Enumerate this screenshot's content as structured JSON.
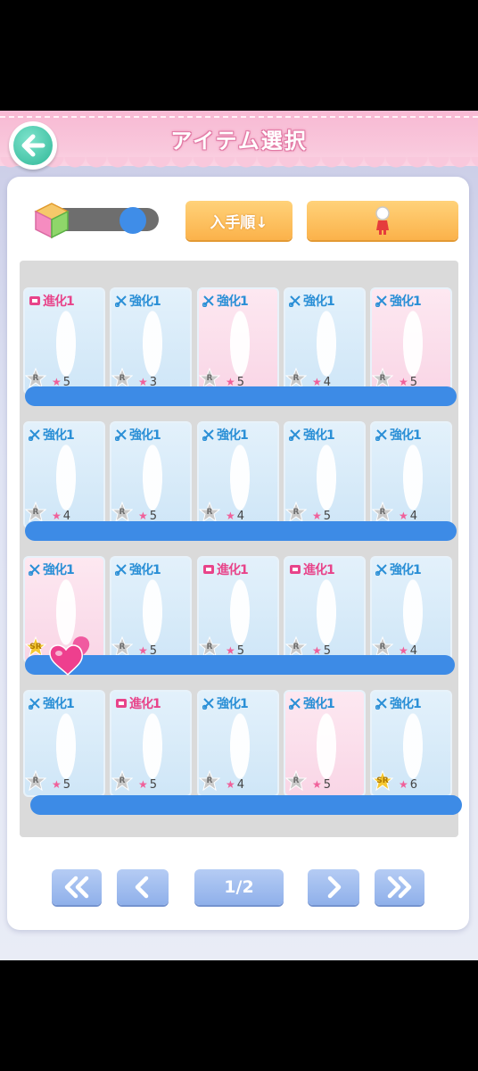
{
  "header": {
    "title": "アイテム選択"
  },
  "toolbar": {
    "sort_label": "入手順↓"
  },
  "pager": {
    "page": "1/2"
  },
  "items": [
    {
      "tag": "進化1",
      "type": "evo",
      "rank": "R",
      "stars": "5",
      "bg": "blue"
    },
    {
      "tag": "強化1",
      "type": "enh",
      "rank": "R",
      "stars": "3",
      "bg": "blue"
    },
    {
      "tag": "強化1",
      "type": "enh",
      "rank": "R",
      "stars": "5",
      "bg": "pink"
    },
    {
      "tag": "強化1",
      "type": "enh",
      "rank": "R",
      "stars": "4",
      "bg": "blue"
    },
    {
      "tag": "強化1",
      "type": "enh",
      "rank": "R",
      "stars": "5",
      "bg": "pink"
    },
    {
      "tag": "強化1",
      "type": "enh",
      "rank": "R",
      "stars": "4",
      "bg": "blue"
    },
    {
      "tag": "強化1",
      "type": "enh",
      "rank": "R",
      "stars": "5",
      "bg": "blue"
    },
    {
      "tag": "強化1",
      "type": "enh",
      "rank": "R",
      "stars": "4",
      "bg": "blue"
    },
    {
      "tag": "強化1",
      "type": "enh",
      "rank": "R",
      "stars": "5",
      "bg": "blue"
    },
    {
      "tag": "強化1",
      "type": "enh",
      "rank": "R",
      "stars": "4",
      "bg": "blue"
    },
    {
      "tag": "強化1",
      "type": "enh",
      "rank": "SR",
      "stars": "",
      "bg": "pink"
    },
    {
      "tag": "強化1",
      "type": "enh",
      "rank": "R",
      "stars": "5",
      "bg": "blue"
    },
    {
      "tag": "進化1",
      "type": "evo",
      "rank": "R",
      "stars": "5",
      "bg": "blue"
    },
    {
      "tag": "進化1",
      "type": "evo",
      "rank": "R",
      "stars": "5",
      "bg": "blue"
    },
    {
      "tag": "強化1",
      "type": "enh",
      "rank": "R",
      "stars": "4",
      "bg": "blue"
    },
    {
      "tag": "強化1",
      "type": "enh",
      "rank": "R",
      "stars": "5",
      "bg": "blue"
    },
    {
      "tag": "進化1",
      "type": "evo",
      "rank": "R",
      "stars": "5",
      "bg": "blue"
    },
    {
      "tag": "強化1",
      "type": "enh",
      "rank": "R",
      "stars": "4",
      "bg": "blue"
    },
    {
      "tag": "強化1",
      "type": "enh",
      "rank": "R",
      "stars": "5",
      "bg": "pink"
    },
    {
      "tag": "強化1",
      "type": "enh",
      "rank": "SR",
      "stars": "6",
      "bg": "blue"
    }
  ],
  "colors": {
    "accent_blue": "#3d8be6",
    "button_orange": "#fbb24a",
    "header_pink": "#f8b9d3",
    "back_green": "#2fb898"
  },
  "icons": {
    "back": "arrow-left-icon",
    "cube": "cube-icon",
    "avatar": "avatar-icon",
    "heart": "heart-icon"
  }
}
